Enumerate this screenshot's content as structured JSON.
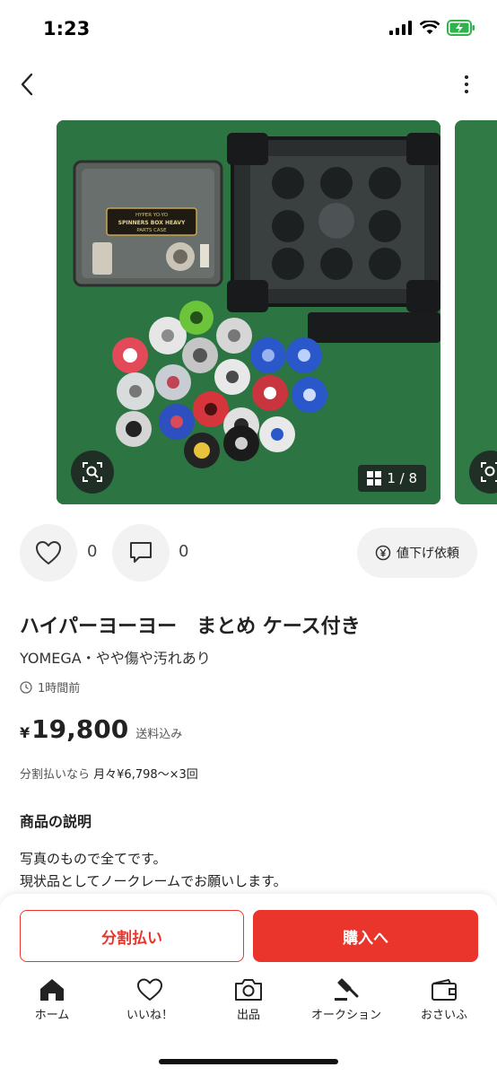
{
  "status": {
    "time": "1:23"
  },
  "gallery": {
    "counter": "1 / 8"
  },
  "engagement": {
    "likes": "0",
    "comments": "0",
    "price_down_label": "値下げ依頼"
  },
  "item": {
    "title": "ハイパーヨーヨー　まとめ ケース付き",
    "subtitle": "YOMEGA・やや傷や汚れあり",
    "posted": "1時間前",
    "currency": "¥",
    "price": "19,800",
    "shipping": "送料込み",
    "installment_prefix": "分割払いなら",
    "installment_value": "月々¥6,798～×3回"
  },
  "description": {
    "heading": "商品の説明",
    "line1": "写真のもので全てです。",
    "line2": "現状品としてノークレームでお願いします。"
  },
  "buttons": {
    "split": "分割払い",
    "buy": "購入へ"
  },
  "tabs": [
    {
      "label": "ホーム",
      "icon": "home-icon"
    },
    {
      "label": "いいね！",
      "icon": "heart-icon"
    },
    {
      "label": "出品",
      "icon": "camera-icon"
    },
    {
      "label": "オークション",
      "icon": "gavel-icon"
    },
    {
      "label": "おさいふ",
      "icon": "wallet-icon"
    }
  ],
  "colors": {
    "accent": "#ea352d",
    "photo_bg": "#2f7a45"
  },
  "photo": {
    "case_lid_text_1": "HYPER YO-YO",
    "case_lid_text_2": "SPINNERS BOX HEAVY",
    "case_lid_text_3": "PARTS CASE"
  }
}
